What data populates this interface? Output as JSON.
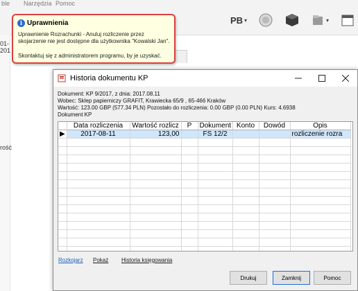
{
  "app": {
    "menu": [
      "ble",
      "Narzędzia",
      "Pomoc"
    ],
    "toolbar_pb": "PB",
    "left_tab_text": "01-201",
    "left_fragment": "rość"
  },
  "tooltip": {
    "title": "Uprawnienia",
    "body": "Uprawnienie Rozrachunki - Anuluj rozliczenie przez skojarzenie nie jest dostępne dla użytkownika \"Kowalski Jan\".",
    "contact": "Skontaktuj się z administratorem programu, by je uzyskać."
  },
  "dialog": {
    "title": "Historia dokumentu KP",
    "info": {
      "line1": "Dokument: KP 9/2017, z dnia: 2017.08.11",
      "line2": "Wobec: Sklep papierniczy GRAFIT, Krawiecka  65/9 , 65-466 Kraków",
      "line3": "Wartość: 123.00 GBP (577.34 PLN) Pozostało do rozliczenia: 0.00 GBP (0.00 PLN) Kurs: 4.6938",
      "line4": "Dokument KP"
    },
    "grid": {
      "columns": [
        "Data rozliczenia",
        "Wartość rozlicz",
        "P",
        "Dokument",
        "Konto",
        "Dowód",
        "Opis"
      ],
      "rows": [
        [
          "2017-08-11",
          "123,00",
          "",
          "FS 12/2",
          "",
          "",
          "rozliczenie rozra"
        ]
      ]
    },
    "links": {
      "rozkojarz": "Rozkojarz",
      "pokaz": "Pokaż",
      "historia": "Historia księgowania"
    },
    "buttons": {
      "drukuj": "Drukuj",
      "zamknij": "Zamknij",
      "pomoc": "Pomoc"
    }
  },
  "colors": {
    "tooltip_border": "#d94040",
    "tooltip_bg": "#ffffe1",
    "selection": "#cfe6fb",
    "link": "#1a5fb4"
  }
}
